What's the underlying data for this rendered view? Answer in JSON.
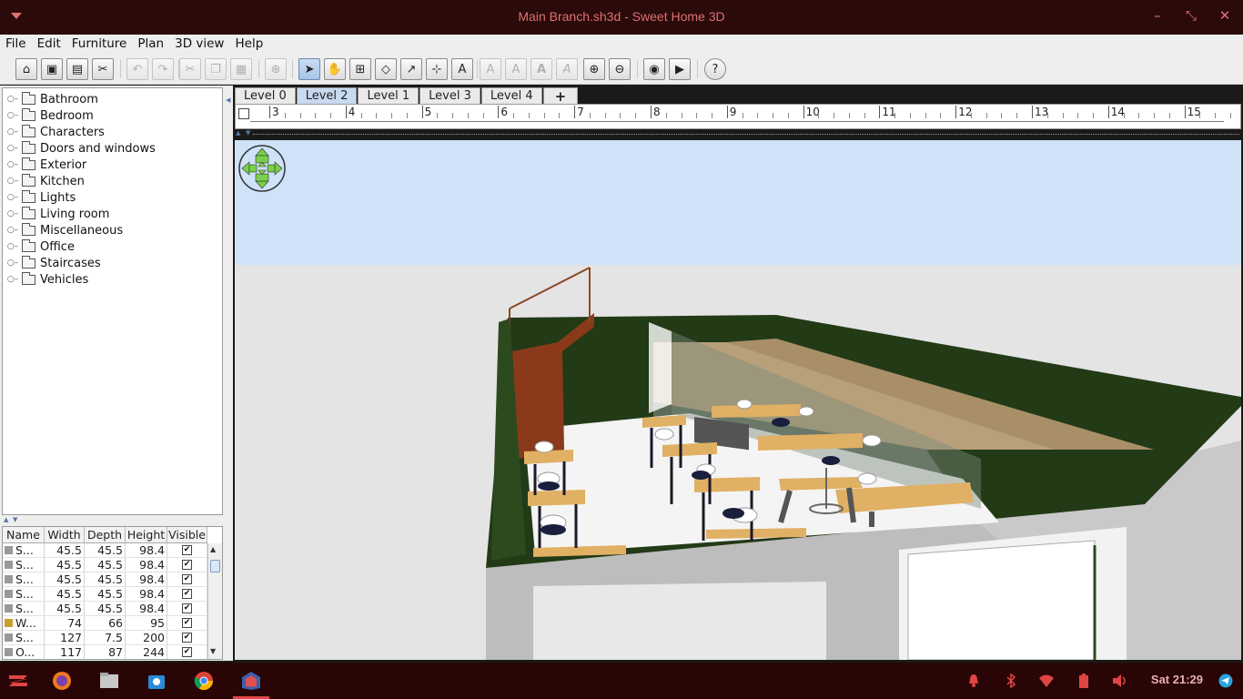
{
  "window": {
    "title": "Main Branch.sh3d - Sweet Home 3D"
  },
  "menu": [
    "File",
    "Edit",
    "Furniture",
    "Plan",
    "3D view",
    "Help"
  ],
  "toolbar": {
    "buttons": [
      "new-home",
      "open",
      "save",
      "preferences",
      "undo",
      "redo",
      "cut",
      "copy",
      "paste",
      "add-furniture",
      "select",
      "pan",
      "create-walls",
      "create-rooms",
      "create-polylines",
      "create-dimensions",
      "add-text",
      "increase-text",
      "decrease-text",
      "bold-text",
      "italic-text",
      "zoom-in",
      "zoom-out",
      "create-photo",
      "create-video",
      "help"
    ]
  },
  "catalog": {
    "categories": [
      "Bathroom",
      "Bedroom",
      "Characters",
      "Doors and windows",
      "Exterior",
      "Kitchen",
      "Lights",
      "Living room",
      "Miscellaneous",
      "Office",
      "Staircases",
      "Vehicles"
    ]
  },
  "furniture_table": {
    "headers": [
      "Name",
      "Width",
      "Depth",
      "Height",
      "Visible"
    ],
    "rows": [
      {
        "name": "S...",
        "width": "45.5",
        "depth": "45.5",
        "height": "98.4",
        "visible": "✔"
      },
      {
        "name": "S...",
        "width": "45.5",
        "depth": "45.5",
        "height": "98.4",
        "visible": "✔"
      },
      {
        "name": "S...",
        "width": "45.5",
        "depth": "45.5",
        "height": "98.4",
        "visible": "✔"
      },
      {
        "name": "S...",
        "width": "45.5",
        "depth": "45.5",
        "height": "98.4",
        "visible": "✔"
      },
      {
        "name": "S...",
        "width": "45.5",
        "depth": "45.5",
        "height": "98.4",
        "visible": "✔"
      },
      {
        "name": "W...",
        "width": "74",
        "depth": "66",
        "height": "95",
        "visible": "✔"
      },
      {
        "name": "S...",
        "width": "127",
        "depth": "7.5",
        "height": "200",
        "visible": "✔"
      },
      {
        "name": "O...",
        "width": "117",
        "depth": "87",
        "height": "244",
        "visible": "✔"
      }
    ]
  },
  "levels": {
    "tabs": [
      "Level 0",
      "Level 2",
      "Level 1",
      "Level 3",
      "Level 4"
    ],
    "selected": "Level 2",
    "add_label": "+"
  },
  "ruler": {
    "labels": [
      "3",
      "4",
      "5",
      "6",
      "7",
      "8",
      "9",
      "10",
      "11",
      "12",
      "13",
      "14",
      "15"
    ]
  },
  "taskbar": {
    "apps": [
      "zorin-menu",
      "firefox",
      "files",
      "software-store",
      "chrome",
      "sweet-home-3d"
    ],
    "clock": "Sat 21:29"
  },
  "colors": {
    "title_bg": "#2b0a0a",
    "title_text": "#e07070",
    "selected_tab": "#c8daf0",
    "sky": "#cfe2f8",
    "ground": "#e4e4e4",
    "wall_top": "#223a16"
  }
}
